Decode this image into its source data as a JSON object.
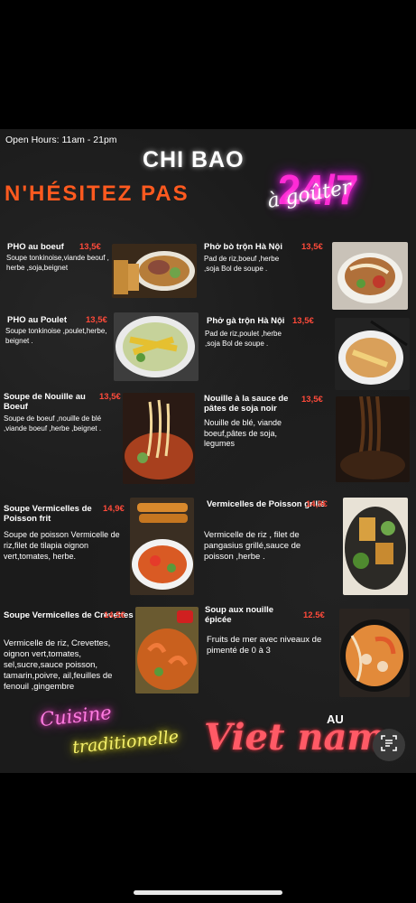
{
  "header": {
    "open_hours": "Open Hours: 11am - 21pm",
    "brand": "CHI BAO",
    "slogan": "N'HÉSITEZ PAS",
    "neon_247": "24/7",
    "neon_agouter": "à goûter"
  },
  "items": [
    {
      "name": "PHO au boeuf",
      "price": "13,5€",
      "desc": "Soupe tonkinoise,viande beouf , herbe ,soja,beignet"
    },
    {
      "name": "Phở bò trộn  Hà  Nội",
      "price": "13,5€",
      "desc": "Pad de riz,boeuf ,herbe ,soja Bol de soupe ."
    },
    {
      "name": "PHO au Poulet",
      "price": "13,5€",
      "desc": "Soupe tonkinoise ,poulet,herbe, beignet ."
    },
    {
      "name": "Phở gà trộn Hà Nội",
      "price": "13,5€",
      "desc": "Pad de riz,poulet ,herbe ,soja Bol de soupe ."
    },
    {
      "name": "Soupe de Nouille au Boeuf",
      "price": "13,5€",
      "desc": "Soupe de boeuf ,nouille de blé ,viande boeuf ,herbe ,beignet ."
    },
    {
      "name": "Nouille à la sauce de pâtes de soja noir",
      "price": "13,5€",
      "desc": "Nouille de blé, viande boeuf,pâtes de soja, legumes"
    },
    {
      "name": "Soupe Vermicelles de Poisson frit",
      "price": "14,9€",
      "desc": "Soupe de poisson Vermicelle de riz,filet de tilapia oignon vert,tomates, herbe."
    },
    {
      "name": "Vermicelles de Poisson grillé",
      "price": "14,9€",
      "desc": "Vermicelle de riz , filet de pangasius grillé,sauce de poisson ,herbe ."
    },
    {
      "name": "Soupe  Vermicelles de  Crevettes",
      "price": "14,5€",
      "desc": "Vermicelle de riz, Crevettes, oignon vert,tomates, sel,sucre,sauce poisson, tamarin,poivre, ail,feuilles de fenouil ,gingembre"
    },
    {
      "name": "Soup aux  nouille épicée",
      "price": "12.5€",
      "desc": "Fruits de mer avec niveaux de pimenté de 0 à 3"
    }
  ],
  "footer": {
    "cuisine": "Cuisine",
    "traditionelle": "traditionelle",
    "au": "AU",
    "vietnam": "Viet nam"
  },
  "icons": {
    "scan": "scan-text-icon"
  }
}
